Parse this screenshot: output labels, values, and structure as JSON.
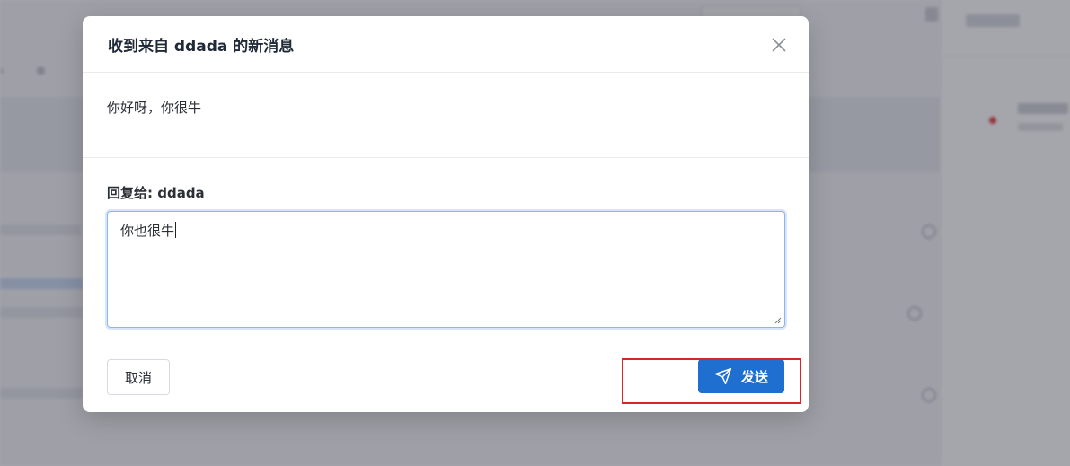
{
  "modal": {
    "title": "收到来自 ddada 的新消息",
    "message": "你好呀，你很牛",
    "reply_label": "回复给: ddada",
    "reply_value": "你也很牛",
    "cancel_label": "取消",
    "send_label": "发送",
    "close_icon": "close-icon",
    "send_icon": "paper-plane-icon"
  },
  "colors": {
    "primary": "#1f6fd1",
    "highlight": "#d9252a",
    "unread_dot": "#e03b3b"
  }
}
